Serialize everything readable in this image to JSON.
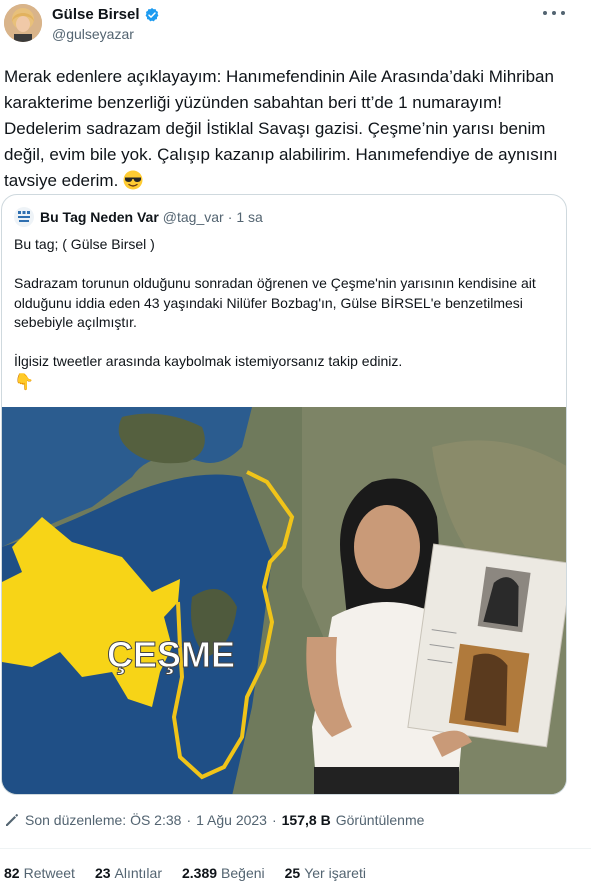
{
  "author": {
    "display_name": "Gülse Birsel",
    "handle": "@gulseyazar",
    "verified_color": "#1d9bf0"
  },
  "tweet": {
    "text": "Merak edenlere açıklayayım: Hanımefendinin Aile Arasında’daki Mihriban karakterime benzerliği yüzünden sabahtan beri tt’de 1 numarayım! Dedelerim sadrazam değil İstiklal Savaşı gazisi. Çeşme’nin yarısı benim değil, evim bile yok. Çalışıp kazanıp alabilirim. Hanımefendiye de aynısını tavsiye ederim.",
    "emoji": "smiling-face-with-sunglasses"
  },
  "quote": {
    "display_name": "Bu Tag Neden Var",
    "handle": "@tag_var",
    "separator": "·",
    "time": "1 sa",
    "line1": "Bu tag; ( Gülse Birsel )",
    "paragraph2": "Sadrazam torunun olduğunu sonradan öğrenen ve Çeşme'nin yarısının kendisine ait olduğunu iddia eden 43 yaşındaki Nilüfer Bozbag'ın, Gülse BİRSEL'e benzetilmesi sebebiyle açılmıştır.",
    "paragraph3": "İlgisiz tweetler arasında kaybolmak istemiyorsanız takip ediniz.",
    "hand_emoji": "👇",
    "image_label": "ÇEŞME"
  },
  "meta": {
    "edited": "Son düzenleme: ÖS 2:38",
    "separator": "·",
    "date": "1 Ağu 2023",
    "separator2": "·",
    "views_count": "157,8 B",
    "views_label": "Görüntülenme"
  },
  "stats": [
    {
      "count": "82",
      "label": "Retweet"
    },
    {
      "count": "23",
      "label": "Alıntılar"
    },
    {
      "count": "2.389",
      "label": "Beğeni"
    },
    {
      "count": "25",
      "label": "Yer işareti"
    }
  ]
}
